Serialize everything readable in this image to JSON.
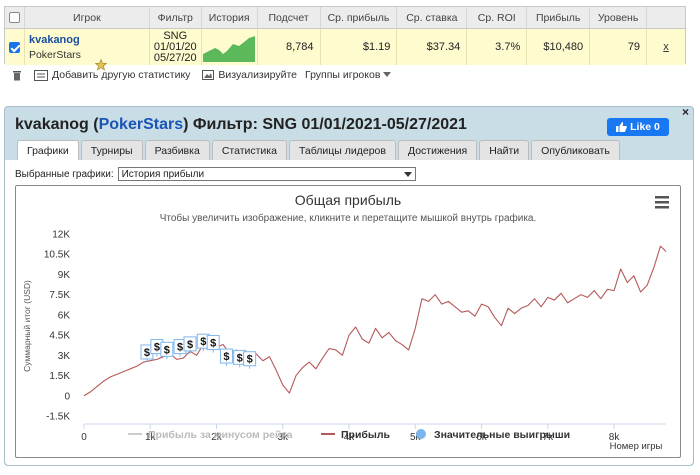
{
  "table": {
    "headers": [
      "",
      "Игрок",
      "Фильтр",
      "История",
      "Подсчет",
      "Ср. прибыль",
      "Ср. ставка",
      "Ср. ROI",
      "Прибыль",
      "Уровень",
      ""
    ],
    "row": {
      "player": "kvakanog",
      "site": "PokerStars",
      "filter_lines": [
        "SNG",
        "01/01/20",
        "05/27/20"
      ],
      "count": "8,784",
      "avg_profit": "$1.19",
      "avg_stake": "$37.34",
      "avg_roi": "3.7%",
      "profit": "$10,480",
      "level": "79",
      "remove": "x"
    }
  },
  "toolbar": {
    "add_stats": "Добавить другую статистику",
    "visualize": "Визуализируйте",
    "groups": "Группы игроков"
  },
  "panel": {
    "title_player": "kvakanog",
    "title_site": "PokerStars",
    "title_filter": "Фильтр: SNG 01/01/2021-05/27/2021",
    "like": "Like 0",
    "close": "×",
    "tabs": [
      "Графики",
      "Турниры",
      "Разбивка",
      "Статистика",
      "Таблицы лидеров",
      "Достижения",
      "Найти",
      "Опубликовать"
    ],
    "select_label": "Выбранные графики:",
    "select_value": "История прибыли"
  },
  "chart_data": {
    "type": "line",
    "title": "Общая прибыль",
    "subtitle": "Чтобы увеличить изображение, кликните и перетащите мышкой внутрь графика.",
    "ylabel": "Суммарный итог (USD)",
    "xlabel": "Номер игры",
    "yticks": [
      "-1.5K",
      "0",
      "1.5K",
      "3K",
      "4.5K",
      "6K",
      "7.5K",
      "9K",
      "10.5K",
      "12K"
    ],
    "xticks": [
      "0",
      "1k",
      "2k",
      "3k",
      "4k",
      "5k",
      "6k",
      "7k",
      "8k"
    ],
    "ylim": [
      -1500,
      12000
    ],
    "xlim": [
      0,
      8784
    ],
    "legend": [
      "Прибыль за минусом рейка",
      "Прибыль",
      "Значительные выигрыши"
    ],
    "colors": {
      "profit": "#b5585a",
      "rake": "#cccccc",
      "big_wins": "#7cb5ec"
    },
    "series": [
      {
        "name": "Прибыль",
        "x": [
          0,
          100,
          200,
          300,
          400,
          500,
          600,
          700,
          800,
          900,
          1000,
          1100,
          1200,
          1300,
          1400,
          1500,
          1600,
          1700,
          1800,
          1900,
          2000,
          2100,
          2200,
          2300,
          2400,
          2500,
          2600,
          2700,
          2800,
          2900,
          3000,
          3100,
          3200,
          3300,
          3400,
          3500,
          3600,
          3700,
          3800,
          3900,
          4000,
          4100,
          4200,
          4300,
          4400,
          4500,
          4600,
          4700,
          4800,
          4900,
          5000,
          5100,
          5200,
          5300,
          5400,
          5500,
          5600,
          5700,
          5800,
          5900,
          6000,
          6100,
          6200,
          6300,
          6400,
          6500,
          6600,
          6700,
          6800,
          6900,
          7000,
          7100,
          7200,
          7300,
          7400,
          7500,
          7600,
          7700,
          7800,
          7900,
          8000,
          8100,
          8200,
          8300,
          8400,
          8500,
          8600,
          8700,
          8784
        ],
        "values": [
          0,
          300,
          700,
          1100,
          1400,
          1600,
          1800,
          2000,
          2200,
          2500,
          2600,
          2700,
          2900,
          3100,
          2700,
          2800,
          3300,
          3000,
          3800,
          3500,
          3600,
          3800,
          3100,
          3400,
          2800,
          2700,
          3100,
          2600,
          2900,
          1900,
          800,
          200,
          1500,
          2100,
          2500,
          2000,
          2800,
          3500,
          3400,
          3000,
          4500,
          5100,
          4200,
          3900,
          5000,
          4300,
          4700,
          4100,
          3800,
          3400,
          5000,
          7200,
          7000,
          7500,
          6800,
          7000,
          6600,
          6200,
          6300,
          5900,
          6800,
          6600,
          5800,
          5200,
          6500,
          6100,
          6500,
          6700,
          7200,
          6600,
          7300,
          7100,
          7600,
          6900,
          7200,
          7500,
          7300,
          7800,
          7200,
          7900,
          7800,
          9400,
          8400,
          8900,
          7700,
          8200,
          9500,
          11100,
          10700
        ]
      },
      {
        "name": "Значительные выигрыши",
        "x": [
          950,
          1100,
          1250,
          1450,
          1600,
          1800,
          1950,
          2150,
          2350,
          2500
        ],
        "values": [
          3100,
          3500,
          3300,
          3500,
          3700,
          3900,
          3800,
          2800,
          2700,
          2600
        ]
      }
    ]
  }
}
